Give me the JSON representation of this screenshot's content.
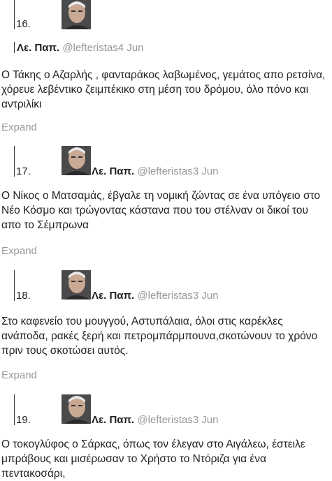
{
  "tweets": [
    {
      "number": "16.",
      "name": "Λε. Παπ.",
      "handle": "@lefteristas4 Jun",
      "text": "Ο Τάκης ο Αζαρλής , φανταράκος λαβωμένος, γεμάτος απο ρετσίνα, χόρευε λεβέντικο ζειμπέκικο στη μέση του δρόμου, όλο πόνο και αντριλίκι",
      "expand": "Expand"
    },
    {
      "number": "17.",
      "name": "Λε. Παπ.",
      "handle": "@lefteristas3 Jun",
      "text": "Ο Νίκος ο Ματσαμάς, έβγαλε τη νομική ζώντας σε ένα υπόγειο στο Νέο Κόσμο και τρώγοντας κάστανα που του στέλναν οι δικοί του απο το Σέμπρωνα",
      "expand": "Expand"
    },
    {
      "number": "18.",
      "name": "Λε. Παπ.",
      "handle": "@lefteristas3 Jun",
      "text": "Στο καφενείο του μουγγού, Αστυπάλαια, όλοι στις καρέκλες ανάποδα, ρακές ξερή και πετρομπάρμπουνα,σκοτώνουν το χρόνο πριν τους σκοτώσει αυτός.",
      "expand": "Expand"
    },
    {
      "number": "19.",
      "name": "Λε. Παπ.",
      "handle": "@lefteristas3 Jun",
      "text": "Ο τοκογλύφος ο Σάρκας, όπως τον έλεγαν στο Αιγάλεω, έστειλε μπράβους και μισέρωσαν το Χρήστο το Ντόριζα για ένα πεντακοσάρι,",
      "expand": ""
    }
  ]
}
